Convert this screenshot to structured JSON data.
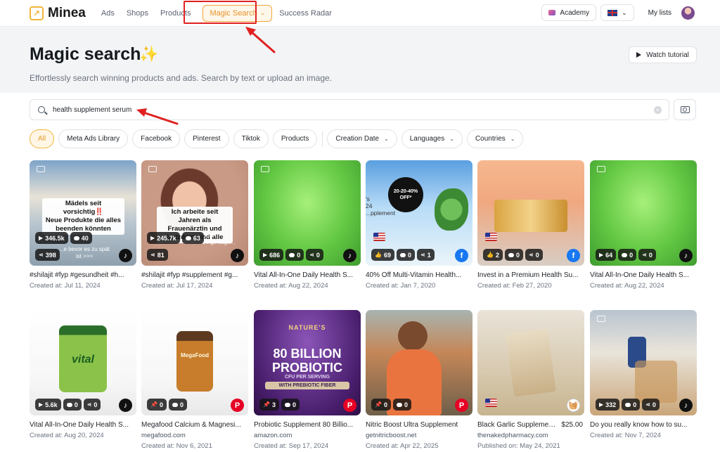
{
  "nav": {
    "brand": "Minea",
    "links": [
      {
        "label": "Ads"
      },
      {
        "label": "Shops"
      },
      {
        "label": "Products"
      },
      {
        "label": "Magic Search"
      },
      {
        "label": "Success Radar"
      }
    ],
    "academy": "Academy",
    "my_lists": "My lists"
  },
  "header": {
    "title": "Magic search",
    "subtitle": "Effortlessly search winning products and ads. Search by text or upload an image.",
    "watch_tutorial": "Watch tutorial"
  },
  "search": {
    "value": "health supplement serum"
  },
  "filters": {
    "chips": [
      "All",
      "Meta Ads Library",
      "Facebook",
      "Pinterest",
      "Tiktok",
      "Products"
    ],
    "dropdowns": [
      "Creation Date",
      "Languages",
      "Countries"
    ]
  },
  "cards": [
    {
      "title": "#shilajit #fyp #gesundheit #h...",
      "date": "Created at: Jul 11, 2024",
      "stats": [
        "346.5k",
        "40",
        "398"
      ],
      "platform": "tiktok",
      "overlay": "Mädels seit vorsichtig‼️\nNeue Produkte die alles beenden könnten",
      "overlay_sub": "...e bevor es zu spät\nist >>>"
    },
    {
      "title": "#shilajit #fyp #supplement #g...",
      "date": "Created at: Jul 17, 2024",
      "stats": [
        "245.7k",
        "63",
        "81"
      ],
      "platform": "tiktok",
      "overlay": "Ich arbeite seit Jahren als Frauenärztin und trotzdem sind alle",
      "overlay_sub": "...ich\n...iese Dinge sage..."
    },
    {
      "title": "Vital All-In-One Daily Health S...",
      "date": "Created at: Aug 22, 2024",
      "stats": [
        "686",
        "0",
        "0"
      ],
      "platform": "tiktok"
    },
    {
      "title": "40% Off Multi-Vitamin Health...",
      "date": "Created at: Jan 7, 2020",
      "stats": [
        "69",
        "0",
        "1"
      ],
      "platform": "facebook",
      "disc": "20-20-40%\nOFF*",
      "side_text": "'s\n24\n...pplement"
    },
    {
      "title": "Invest in a Premium Health Su...",
      "date": "Created at: Feb 27, 2020",
      "stats": [
        "2",
        "0",
        "0"
      ],
      "platform": "facebook"
    },
    {
      "title": "Vital All-In-One Daily Health S...",
      "date": "Created at: Aug 22, 2024",
      "stats": [
        "64",
        "0",
        "0"
      ],
      "platform": "tiktok"
    },
    {
      "title": "Vital All-In-One Daily Health S...",
      "date": "Created at: Aug 20, 2024",
      "stats": [
        "5.6k",
        "0",
        "0"
      ],
      "platform": "tiktok",
      "label": "vital"
    },
    {
      "title": "Megafood Calcium & Magnesi...",
      "date": "Created at: Nov 6, 2021",
      "stats": [
        "0",
        "0"
      ],
      "platform": "pinterest",
      "domain": "megafood.com",
      "label": "MegaFood"
    },
    {
      "title": "Probiotic Supplement 80 Billio...",
      "date": "Created at: Sep 17, 2024",
      "stats": [
        "3",
        "0"
      ],
      "platform": "pinterest",
      "domain": "amazon.com",
      "brand": "NATURE'S",
      "big1": "80 BILLION",
      "big2": "PROBIOTIC",
      "small1": "CFU PER SERVING",
      "small2": "WITH PREBIOTIC FIBER"
    },
    {
      "title": "Nitric Boost Ultra Supplement",
      "date": "Created at: Apr 22, 2025",
      "stats": [
        "0",
        "0"
      ],
      "platform": "pinterest",
      "domain": "getnitricboost.net"
    },
    {
      "title": "Black Garlic Supplemen...",
      "price": "$25.00",
      "date": "Published on: May 24, 2021",
      "platform": "shop",
      "domain": "thenakedpharmacy.com"
    },
    {
      "title": "Do you really know how to su...",
      "date": "Created at: Nov 7, 2024",
      "stats": [
        "332",
        "0",
        "0"
      ],
      "platform": "tiktok"
    }
  ],
  "colors": {
    "accent": "#f2a63a",
    "annotation": "#e02020"
  }
}
